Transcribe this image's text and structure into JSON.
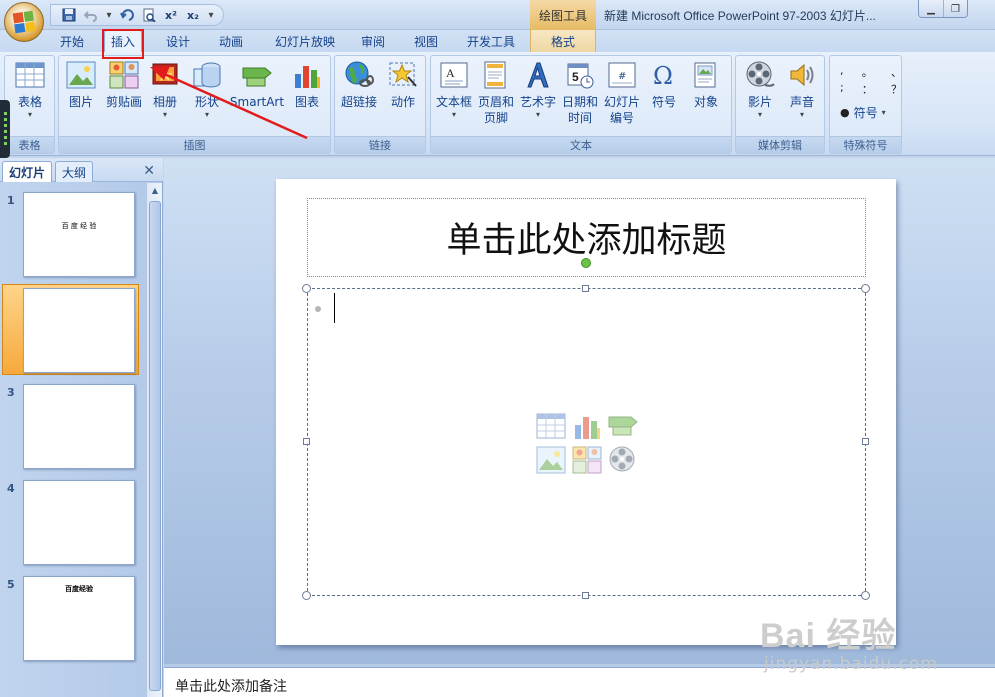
{
  "window": {
    "title": "新建 Microsoft Office PowerPoint 97-2003 幻灯片...",
    "context_tool": "绘图工具"
  },
  "qat": {
    "save": "save-icon",
    "undo": "undo-icon",
    "redo": "redo-icon",
    "preview": "print-preview-icon",
    "superscript": "x²",
    "subscript": "x₂",
    "customize": "▾"
  },
  "tabs": [
    {
      "label": "开始",
      "active": false
    },
    {
      "label": "插入",
      "active": true
    },
    {
      "label": "设计",
      "active": false
    },
    {
      "label": "动画",
      "active": false
    },
    {
      "label": "幻灯片放映",
      "active": false
    },
    {
      "label": "审阅",
      "active": false
    },
    {
      "label": "视图",
      "active": false
    },
    {
      "label": "开发工具",
      "active": false
    },
    {
      "label": "格式",
      "active": false,
      "contextual": true
    }
  ],
  "ribbon": {
    "groups": {
      "table": "表格",
      "illustrations": "插图",
      "links": "链接",
      "text": "文本",
      "media": "媒体剪辑",
      "special_symbols": "特殊符号"
    },
    "buttons": {
      "table": "表格",
      "picture": "图片",
      "clipart": "剪贴画",
      "album": "相册",
      "shapes": "形状",
      "smartart": "SmartArt",
      "chart": "图表",
      "hyperlink": "超链接",
      "action": "动作",
      "textbox": "文本框",
      "header_footer_1": "页眉和",
      "header_footer_2": "页脚",
      "wordart": "艺术字",
      "datetime_1": "日期和",
      "datetime_2": "时间",
      "slide_number_1": "幻灯片",
      "slide_number_2": "编号",
      "symbol": "符号",
      "object": "对象",
      "movie": "影片",
      "sound": "声音",
      "special_symbol": "符号"
    },
    "symbol_glyphs": [
      [
        ",",
        "。",
        "、"
      ],
      [
        ";",
        "：",
        "？"
      ]
    ]
  },
  "left_pane": {
    "tab_slides": "幻灯片",
    "tab_outline": "大纲",
    "close": "✕",
    "slides": [
      {
        "num": "1",
        "text": "百      度      经      验",
        "selected": false
      },
      {
        "num": "2",
        "text": "",
        "selected": true
      },
      {
        "num": "3",
        "text": "",
        "selected": false
      },
      {
        "num": "4",
        "text": "",
        "selected": false
      },
      {
        "num": "5",
        "text": "百度经验",
        "selected": false
      }
    ]
  },
  "slide": {
    "title_placeholder": "单击此处添加标题"
  },
  "notes": {
    "placeholder": "单击此处添加备注"
  },
  "watermark": {
    "logo": "Bai 经验",
    "url": "jingyan.baidu.com"
  },
  "colors": {
    "accent_red": "#e21c1c",
    "ribbon_blue": "#15428b",
    "selected_orange": "#f6a93c"
  }
}
